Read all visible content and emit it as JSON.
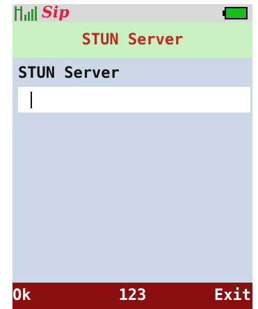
{
  "status": {
    "sip_label": "Sip",
    "signal_icon": "signal-bars-icon",
    "battery_icon": "battery-icon",
    "battery_level": 1.0
  },
  "header": {
    "title": "STUN Server"
  },
  "form": {
    "field_label": "STUN Server",
    "field_value": ""
  },
  "softkeys": {
    "left": "Ok",
    "center": "123",
    "right": "Exit"
  },
  "colors": {
    "screen_bg": "#cdd8e6",
    "title_bg": "#c9f2c2",
    "title_text": "#c0281b",
    "softbar_bg": "#8a1010",
    "signal": "#2a9a2a",
    "battery_fill": "#16c016"
  }
}
